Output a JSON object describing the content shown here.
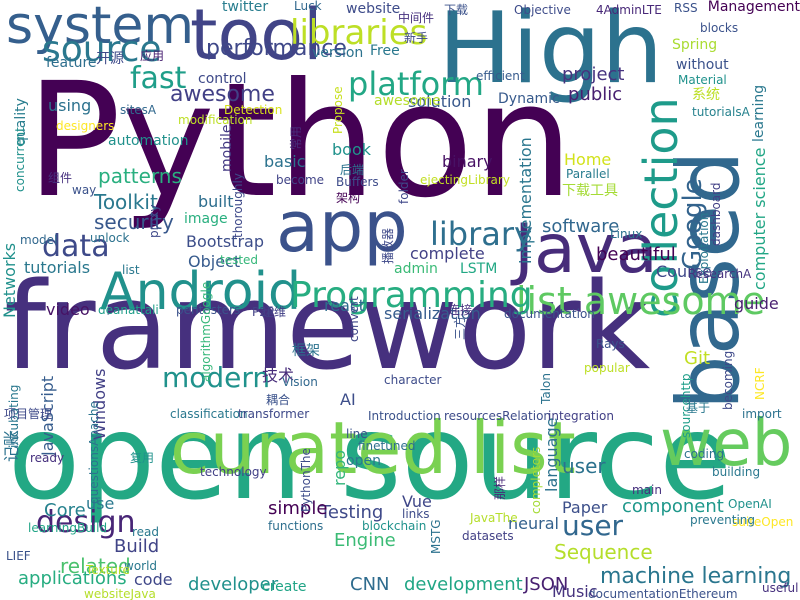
{
  "words": [
    {
      "text": "Python",
      "color": "#440154"
    },
    {
      "text": "framework",
      "color": "#46307e"
    },
    {
      "text": "open source",
      "color": "#23a884"
    },
    {
      "text": "High",
      "color": "#2c728e"
    },
    {
      "text": "based",
      "color": "#31688e"
    },
    {
      "text": "curated list",
      "color": "#7ad151"
    },
    {
      "text": "tool",
      "color": "#414487"
    },
    {
      "text": "app",
      "color": "#3b528b"
    },
    {
      "text": "Java",
      "color": "#472c7a"
    },
    {
      "text": "web",
      "color": "#65cb5e"
    },
    {
      "text": "Android",
      "color": "#21918c"
    },
    {
      "text": "system",
      "color": "#355f8d"
    },
    {
      "text": "collection",
      "color": "#1e9b8a"
    },
    {
      "text": "list awesome",
      "color": "#5ec962"
    },
    {
      "text": "Programming",
      "color": "#27ad81"
    },
    {
      "text": "source",
      "color": "#2a788e"
    },
    {
      "text": "libraries",
      "color": "#bddf26"
    },
    {
      "text": "platform",
      "color": "#22a785"
    },
    {
      "text": "library",
      "color": "#2e6f8e"
    },
    {
      "text": "data",
      "color": "#3e4a89"
    },
    {
      "text": "fast",
      "color": "#1f9e89"
    },
    {
      "text": "design",
      "color": "#482576"
    },
    {
      "text": "modern",
      "color": "#20928c"
    },
    {
      "text": "user",
      "color": "#31678e"
    },
    {
      "text": "Google",
      "color": "#33638d"
    },
    {
      "text": "performance",
      "color": "#3f4889"
    },
    {
      "text": "awesome",
      "color": "#424086"
    },
    {
      "text": "project",
      "color": "#46337f"
    },
    {
      "text": "public",
      "color": "#482071"
    },
    {
      "text": "patterns",
      "color": "#29af7f"
    },
    {
      "text": "Toolkit",
      "color": "#2a788e"
    },
    {
      "text": "security",
      "color": "#38588c"
    },
    {
      "text": "software",
      "color": "#31678e"
    },
    {
      "text": "beautiful",
      "color": "#440154"
    },
    {
      "text": "machine learning",
      "color": "#2a768e"
    },
    {
      "text": "Sequence",
      "color": "#b5de2b"
    },
    {
      "text": "component",
      "color": "#1f988b"
    },
    {
      "text": "Testing",
      "color": "#3e4989"
    },
    {
      "text": "Engine",
      "color": "#3bbb75"
    },
    {
      "text": "related",
      "color": "#4ac16d"
    },
    {
      "text": "applications",
      "color": "#27ad81"
    },
    {
      "text": "developer",
      "color": "#21918c"
    },
    {
      "text": "development",
      "color": "#21a685"
    },
    {
      "text": "CNN",
      "color": "#2f6c8e"
    },
    {
      "text": "JSON",
      "color": "#482071"
    },
    {
      "text": "Music",
      "color": "#46337f"
    },
    {
      "text": "Paper",
      "color": "#3c4f8a"
    },
    {
      "text": "neural",
      "color": "#34618d"
    },
    {
      "text": "language",
      "color": "#2c728e"
    },
    {
      "text": "simple",
      "color": "#440154"
    },
    {
      "text": "Build",
      "color": "#414487"
    },
    {
      "text": "Core",
      "color": "#26828e"
    },
    {
      "text": "use",
      "color": "#2a788e"
    },
    {
      "text": "Vue",
      "color": "#3f4788"
    },
    {
      "text": "Bootstrap",
      "color": "#3d4e8a"
    },
    {
      "text": "Object",
      "color": "#375b8d"
    },
    {
      "text": "complete",
      "color": "#424186"
    },
    {
      "text": "admin",
      "color": "#3aba76"
    },
    {
      "text": "LSTM",
      "color": "#22a884"
    },
    {
      "text": "Course",
      "color": "#3f4889"
    },
    {
      "text": "guide",
      "color": "#481f70"
    },
    {
      "text": "react",
      "color": "#2f6c8e"
    },
    {
      "text": "serialization",
      "color": "#365c8d"
    },
    {
      "text": "video",
      "color": "#471365"
    },
    {
      "text": "tutorials",
      "color": "#2a788e"
    },
    {
      "text": "Networks",
      "color": "#21918c"
    },
    {
      "text": "JavaScript",
      "color": "#365c8d"
    },
    {
      "text": "Windows",
      "color": "#424086"
    },
    {
      "text": "AI",
      "color": "#3d4e8a"
    },
    {
      "text": "repo",
      "color": "#31b57b"
    },
    {
      "text": "open",
      "color": "#2a788e"
    },
    {
      "text": "code",
      "color": "#3f4788"
    },
    {
      "text": "create",
      "color": "#20a486"
    },
    {
      "text": "user",
      "color": "#2c728e"
    },
    {
      "text": "Git",
      "color": "#c2df23"
    },
    {
      "text": "Dynamic",
      "color": "#375a8c"
    },
    {
      "text": "solution",
      "color": "#38588c"
    },
    {
      "text": "binary",
      "color": "#471164"
    },
    {
      "text": "implementation",
      "color": "#2a768e"
    },
    {
      "text": "book",
      "color": "#20928c"
    },
    {
      "text": "Home",
      "color": "#d2e21b"
    },
    {
      "text": "Parallel",
      "color": "#287c8e"
    },
    {
      "text": "basic",
      "color": "#2c728e"
    },
    {
      "text": "built",
      "color": "#2e6e8e"
    },
    {
      "text": "image",
      "color": "#29af7f"
    },
    {
      "text": "mobile",
      "color": "#443a83"
    },
    {
      "text": "thoroughly",
      "color": "#3e4989"
    },
    {
      "text": "using",
      "color": "#2c728e"
    },
    {
      "text": "feature",
      "color": "#2e6f8e"
    },
    {
      "text": "开源",
      "color": "#3e4989"
    },
    {
      "text": "control",
      "color": "#3e4989"
    },
    {
      "text": "version",
      "color": "#2c728e"
    },
    {
      "text": "Free",
      "color": "#2a788e"
    },
    {
      "text": "twitter",
      "color": "#287d8e"
    },
    {
      "text": "website",
      "color": "#3e4c8a"
    },
    {
      "text": "Spring",
      "color": "#aadc32"
    },
    {
      "text": "without",
      "color": "#3b528b"
    },
    {
      "text": "Management",
      "color": "#440154"
    },
    {
      "text": "learning",
      "color": "#2a788e"
    },
    {
      "text": "computer science",
      "color": "#21a685"
    },
    {
      "text": "Objective",
      "color": "#3e4c8a"
    },
    {
      "text": "4AdminLTE",
      "color": "#482878"
    },
    {
      "text": "RSS",
      "color": "#3b528b"
    },
    {
      "text": "Luck",
      "color": "#31688e"
    },
    {
      "text": "中间件",
      "color": "#46307e"
    },
    {
      "text": "下载",
      "color": "#3b528b"
    },
    {
      "text": "新手",
      "color": "#3e4989"
    },
    {
      "text": "应用",
      "color": "#482071"
    },
    {
      "text": "blocks",
      "color": "#3b528b"
    },
    {
      "text": "Material",
      "color": "#20928c"
    },
    {
      "text": "efficient",
      "color": "#375b8d"
    },
    {
      "text": "系统",
      "color": "#bddf26"
    },
    {
      "text": "tutorialsA",
      "color": "#26828e"
    },
    {
      "text": "awesome",
      "color": "#b5de2b"
    },
    {
      "text": "常用",
      "color": "#472c7a"
    },
    {
      "text": "Propose",
      "color": "#c8e020"
    },
    {
      "text": "sitesA",
      "color": "#31688e"
    },
    {
      "text": "Detection",
      "color": "#d8e219"
    },
    {
      "text": "modification",
      "color": "#bddf26"
    },
    {
      "text": "designers",
      "color": "#fde725"
    },
    {
      "text": "quality",
      "color": "#287d8e"
    },
    {
      "text": "automation",
      "color": "#21918c"
    },
    {
      "text": "组件",
      "color": "#46307e"
    },
    {
      "text": "way",
      "color": "#3b528b"
    },
    {
      "text": "concurrent",
      "color": "#21918c"
    },
    {
      "text": "后端",
      "color": "#2c728e"
    },
    {
      "text": "Buffers",
      "color": "#3e4c8a"
    },
    {
      "text": "become",
      "color": "#414487"
    },
    {
      "text": "folder",
      "color": "#3f4889"
    },
    {
      "text": "ejectingLibrary",
      "color": "#c2df23"
    },
    {
      "text": "下载工具",
      "color": "#a5db36"
    },
    {
      "text": "架构",
      "color": "#440154"
    },
    {
      "text": "proxy",
      "color": "#3e4989"
    },
    {
      "text": "model",
      "color": "#31688e"
    },
    {
      "text": "unlock",
      "color": "#2c728e"
    },
    {
      "text": "dashboard",
      "color": "#424086"
    },
    {
      "text": "Exploitation",
      "color": "#2a788e"
    },
    {
      "text": "tested",
      "color": "#35b779"
    },
    {
      "text": "播放器",
      "color": "#3e4989"
    },
    {
      "text": "Linux",
      "color": "#2c728e"
    },
    {
      "text": "list",
      "color": "#2a788e"
    },
    {
      "text": "ResearchA",
      "color": "#46337f"
    },
    {
      "text": "deanattali",
      "color": "#1f9e89"
    },
    {
      "text": "pentesters",
      "color": "#3b528b"
    },
    {
      "text": "P2P",
      "color": "#424086"
    },
    {
      "text": "运维",
      "color": "#424086"
    },
    {
      "text": "convert",
      "color": "#3f4788"
    },
    {
      "text": "三方",
      "color": "#3b528b"
    },
    {
      "text": "连接",
      "color": "#46307e"
    },
    {
      "text": "documentation",
      "color": "#3b528b"
    },
    {
      "text": "algorithmGoogle",
      "color": "#35b779"
    },
    {
      "text": "框架",
      "color": "#2c728e"
    },
    {
      "text": "技术",
      "color": "#472c7a"
    },
    {
      "text": "Vision",
      "color": "#31688e"
    },
    {
      "text": "character",
      "color": "#3e4c8a"
    },
    {
      "text": "popular",
      "color": "#bddf26"
    },
    {
      "text": "Rays",
      "color": "#3b528b"
    },
    {
      "text": "NCRF",
      "color": "#fde725"
    },
    {
      "text": "sourcehttp",
      "color": "#1f9e89"
    },
    {
      "text": "becoming",
      "color": "#3e4989"
    },
    {
      "text": "Talon",
      "color": "#2c728e"
    },
    {
      "text": "incubating",
      "color": "#2a788e"
    },
    {
      "text": "项目管理",
      "color": "#3e4989"
    },
    {
      "text": "耦合",
      "color": "#3b528b"
    },
    {
      "text": "classification",
      "color": "#2a788e"
    },
    {
      "text": "transformer",
      "color": "#3e4989"
    },
    {
      "text": "Introduction",
      "color": "#3b528b"
    },
    {
      "text": "resourcesRelation",
      "color": "#3e4c8a"
    },
    {
      "text": "integration",
      "color": "#424086"
    },
    {
      "text": "基于",
      "color": "#2a788e"
    },
    {
      "text": "import",
      "color": "#2c728e"
    },
    {
      "text": "ready",
      "color": "#46307e"
    },
    {
      "text": "复用",
      "color": "#20928c"
    },
    {
      "text": "questionsApache",
      "color": "#2c728e"
    },
    {
      "text": "technology",
      "color": "#424086"
    },
    {
      "text": "line",
      "color": "#3b528b"
    },
    {
      "text": "PythonThe",
      "color": "#3e4c8a"
    },
    {
      "text": "finetuned",
      "color": "#2e6f8e"
    },
    {
      "text": "completers",
      "color": "#a5db36"
    },
    {
      "text": "coding",
      "color": "#2c728e"
    },
    {
      "text": "building",
      "color": "#2a788e"
    },
    {
      "text": "suiteOpen",
      "color": "#fde725"
    },
    {
      "text": "main",
      "color": "#46307e"
    },
    {
      "text": "OpenAI",
      "color": "#20928c"
    },
    {
      "text": "preventing",
      "color": "#2a788e"
    },
    {
      "text": "那样",
      "color": "#482878"
    },
    {
      "text": "JavaThe",
      "color": "#b5de2b"
    },
    {
      "text": "datasets",
      "color": "#424086"
    },
    {
      "text": "MSTG",
      "color": "#2c728e"
    },
    {
      "text": "links",
      "color": "#3e4c8a"
    },
    {
      "text": "blockchain",
      "color": "#20928c"
    },
    {
      "text": "functions",
      "color": "#2e6f8e"
    },
    {
      "text": "learningBuild",
      "color": "#20a486"
    },
    {
      "text": "read",
      "color": "#2a788e"
    },
    {
      "text": "world",
      "color": "#2a788e"
    },
    {
      "text": "Texture",
      "color": "#b5de2b"
    },
    {
      "text": "websiteJava",
      "color": "#b5de2b"
    },
    {
      "text": "documentationEthereum",
      "color": "#3b528b"
    },
    {
      "text": "useful",
      "color": "#46307e"
    },
    {
      "text": "LIEF",
      "color": "#3b528b"
    },
    {
      "text": "记账",
      "color": "#2c728e"
    }
  ]
}
